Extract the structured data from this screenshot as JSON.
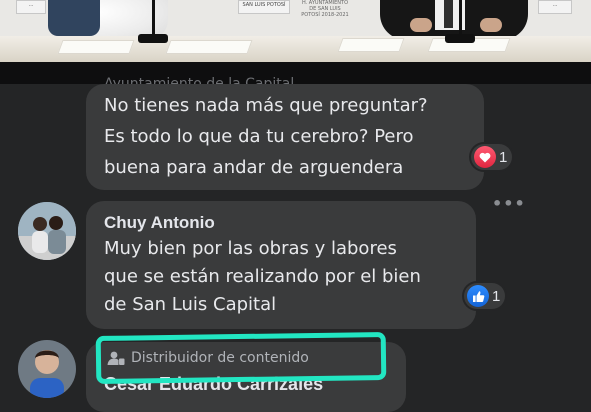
{
  "video": {
    "sign_left": "...",
    "sign_center": "SAN LUIS POTOSÍ",
    "sign_center_sub": "H. AYUNTAMIENTO DE SAN LUIS POTOSÍ 2018-2021",
    "sign_right": "..."
  },
  "comments": [
    {
      "author": "Ayuntamiento de la Capital",
      "text_lines": [
        "No tienes nada más que preguntar?",
        "Es todo lo que da tu cerebro? Pero",
        "buena para andar de arguendera"
      ],
      "reaction": {
        "icon": "heart-icon",
        "count": "1"
      }
    },
    {
      "author": "Chuy Antonio",
      "text_lines": [
        "Muy bien por las obras y labores",
        "que se están realizando por el bien",
        "de San Luis Capital"
      ],
      "reaction": {
        "icon": "thumbs-up-icon",
        "count": "1"
      }
    },
    {
      "badge": "Distribuidor de contenido",
      "author": "Cesar Eduardo Carrizales"
    }
  ],
  "colors": {
    "background": "#242526",
    "bubble": "#3a3b3c",
    "highlight": "#22e6c2",
    "love": "#e1263f",
    "like": "#1464d6"
  }
}
